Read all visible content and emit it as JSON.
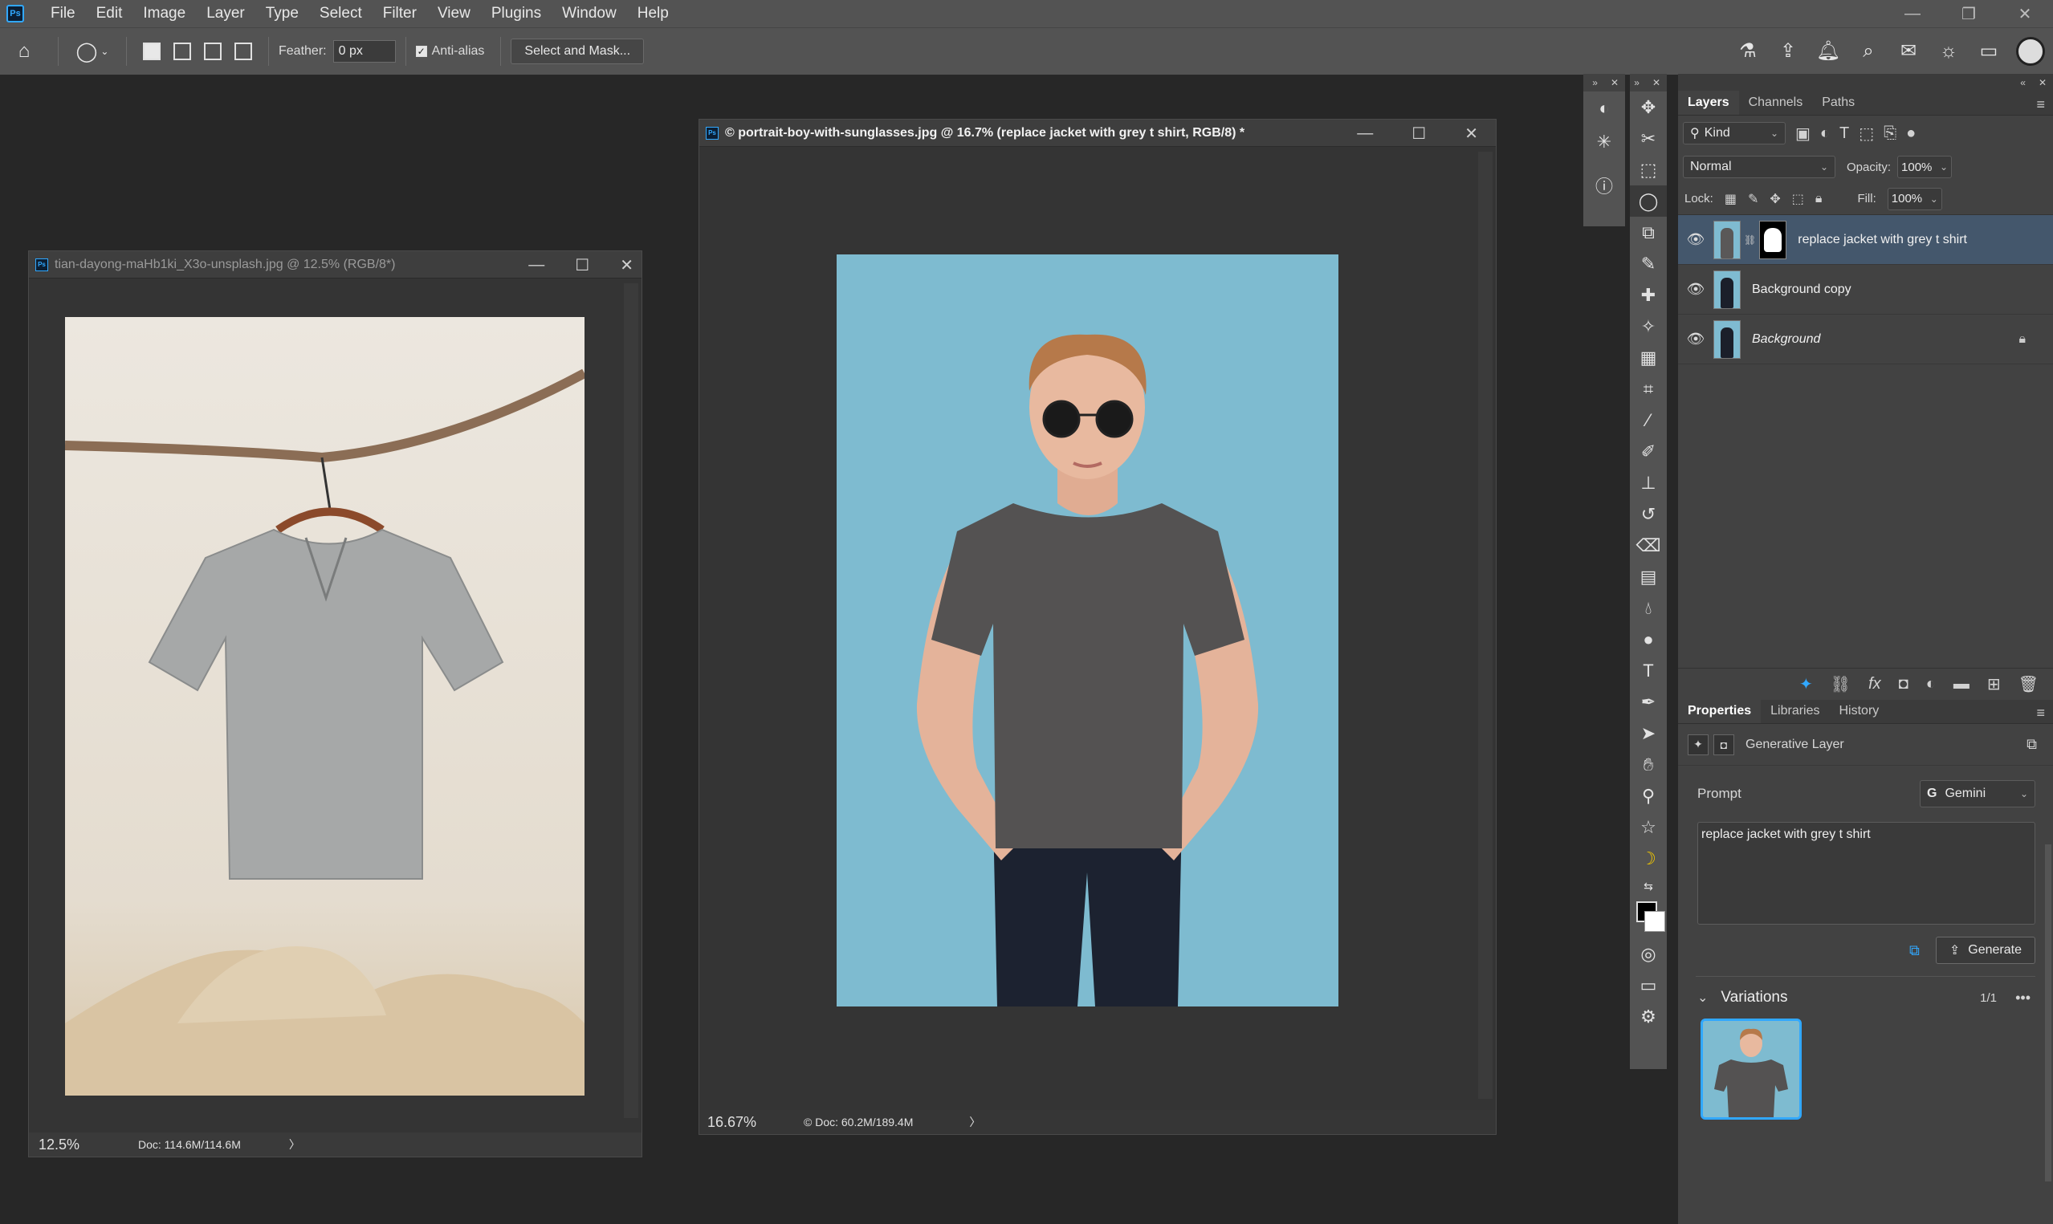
{
  "menu": {
    "items": [
      "File",
      "Edit",
      "Image",
      "Layer",
      "Type",
      "Select",
      "Filter",
      "View",
      "Plugins",
      "Window",
      "Help"
    ]
  },
  "options": {
    "feather_label": "Feather:",
    "feather_value": "0 px",
    "antialias_label": "Anti-alias",
    "select_mask_label": "Select and Mask..."
  },
  "doc1": {
    "title": "tian-dayong-maHb1ki_X3o-unsplash.jpg @ 12.5% (RGB/8*)",
    "zoom": "12.5%",
    "doc_size": "Doc: 114.6M/114.6M"
  },
  "doc2": {
    "title": "© portrait-boy-with-sunglasses.jpg @ 16.7% (replace jacket with grey t shirt, RGB/8) *",
    "zoom": "16.67%",
    "doc_size": "© Doc: 60.2M/189.4M"
  },
  "layers_panel": {
    "tabs": [
      "Layers",
      "Channels",
      "Paths"
    ],
    "filter_kind": "Kind",
    "blend_mode": "Normal",
    "opacity_label": "Opacity:",
    "opacity_value": "100%",
    "lock_label": "Lock:",
    "fill_label": "Fill:",
    "fill_value": "100%",
    "layers": [
      {
        "name": "replace jacket with grey t shirt"
      },
      {
        "name": "Background copy"
      },
      {
        "name": "Background"
      }
    ]
  },
  "properties_panel": {
    "tabs": [
      "Properties",
      "Libraries",
      "History"
    ],
    "layer_type": "Generative Layer",
    "prompt_label": "Prompt",
    "model": "Gemini",
    "prompt_text": "replace jacket with grey t shirt",
    "generate_label": "Generate",
    "variations_label": "Variations",
    "variations_count": "1/1"
  },
  "colors": {
    "accent": "#31a8ff",
    "canvas_bg": "#7fbbd1",
    "selected_layer": "#44576c"
  }
}
